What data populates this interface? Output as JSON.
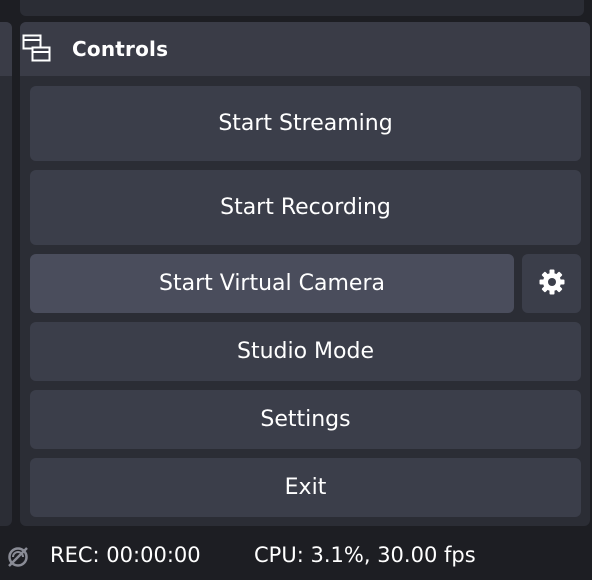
{
  "dock": {
    "title": "Controls",
    "icon": "dock-undock-icon"
  },
  "controls": {
    "start_streaming": "Start Streaming",
    "start_recording": "Start Recording",
    "start_virtual_camera": "Start Virtual Camera",
    "virtual_camera_settings_icon": "gear-icon",
    "studio_mode": "Studio Mode",
    "settings": "Settings",
    "exit": "Exit"
  },
  "status_bar": {
    "icon": "no-stream-icon",
    "rec_label": "REC:",
    "rec_time": "00:00:00",
    "cpu_label": "CPU:",
    "cpu_value": "3.1%,",
    "fps": "30.00 fps"
  },
  "colors": {
    "background": "#1d1e23",
    "panel": "#2b2d35",
    "header": "#3a3c47",
    "button": "#3b3e4a",
    "button_hover": "#4a4d5c",
    "text": "#ffffff"
  }
}
